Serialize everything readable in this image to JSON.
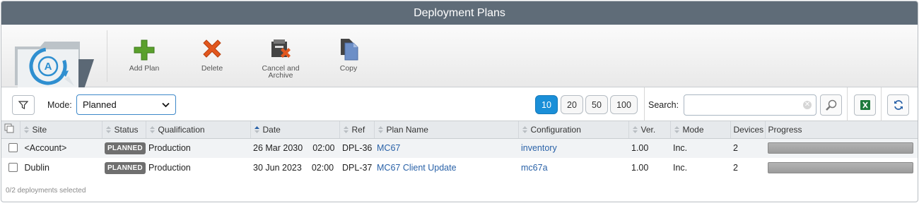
{
  "window": {
    "title": "Deployment Plans"
  },
  "toolbar": {
    "add_plan": "Add Plan",
    "delete": "Delete",
    "cancel_archive": "Cancel and\nArchive",
    "copy": "Copy"
  },
  "filter": {
    "mode_label": "Mode:",
    "mode_value": "Planned",
    "page_sizes": [
      "10",
      "20",
      "50",
      "100"
    ],
    "active_page_size": "10",
    "search_label": "Search:",
    "search_value": ""
  },
  "table": {
    "columns": [
      "Site",
      "Status",
      "Qualification",
      "Date",
      "Ref",
      "Plan Name",
      "Configuration",
      "Ver.",
      "Mode",
      "Devices",
      "Progress"
    ],
    "rows": [
      {
        "site": "<Account>",
        "status": "PLANNED",
        "qualification": "Production",
        "date": "26 Mar 2030",
        "time": "02:00",
        "ref": "DPL-36",
        "plan_name": "MC67",
        "configuration": "inventory",
        "ver": "1.00",
        "mode": "Inc.",
        "devices": "2",
        "progress": 0
      },
      {
        "site": "Dublin",
        "status": "PLANNED",
        "qualification": "Production",
        "date": "30 Jun 2023",
        "time": "02:00",
        "ref": "DPL-37",
        "plan_name": "MC67 Client Update",
        "configuration": "mc67a",
        "ver": "1.00",
        "mode": "Inc.",
        "devices": "2",
        "progress": 0
      }
    ]
  },
  "footer": {
    "selection_text": "0/2 deployments selected"
  },
  "colors": {
    "titlebar": "#5f6c78",
    "accent": "#1a8fd8",
    "link": "#2a62a8",
    "badge": "#6f6f6f"
  }
}
